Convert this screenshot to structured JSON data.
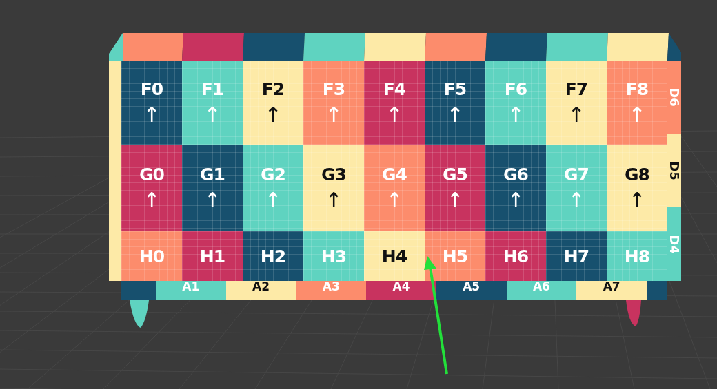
{
  "front_rows": [
    {
      "tiles": [
        {
          "label": "F0",
          "arrow": "↑",
          "color": "#17506e"
        },
        {
          "label": "F1",
          "arrow": "↑",
          "color": "#5fd3c0"
        },
        {
          "label": "F2",
          "arrow": "↑",
          "color": "#fdeaa7"
        },
        {
          "label": "F3",
          "arrow": "↑",
          "color": "#fc8c6c"
        },
        {
          "label": "F4",
          "arrow": "↑",
          "color": "#c8335f"
        },
        {
          "label": "F5",
          "arrow": "↑",
          "color": "#17506e"
        },
        {
          "label": "F6",
          "arrow": "↑",
          "color": "#5fd3c0"
        },
        {
          "label": "F7",
          "arrow": "↑",
          "color": "#fdeaa7"
        },
        {
          "label": "F8",
          "arrow": "↑",
          "color": "#fc8c6c"
        }
      ]
    },
    {
      "tiles": [
        {
          "label": "G0",
          "arrow": "↑",
          "color": "#c8335f"
        },
        {
          "label": "G1",
          "arrow": "↑",
          "color": "#17506e"
        },
        {
          "label": "G2",
          "arrow": "↑",
          "color": "#5fd3c0"
        },
        {
          "label": "G3",
          "arrow": "↑",
          "color": "#fdeaa7"
        },
        {
          "label": "G4",
          "arrow": "↑",
          "color": "#fc8c6c"
        },
        {
          "label": "G5",
          "arrow": "↑",
          "color": "#c8335f"
        },
        {
          "label": "G6",
          "arrow": "↑",
          "color": "#17506e"
        },
        {
          "label": "G7",
          "arrow": "↑",
          "color": "#5fd3c0"
        },
        {
          "label": "G8",
          "arrow": "↑",
          "color": "#fdeaa7"
        }
      ]
    },
    {
      "tiles": [
        {
          "label": "H0",
          "color": "#fc8c6c"
        },
        {
          "label": "H1",
          "color": "#c8335f"
        },
        {
          "label": "H2",
          "color": "#17506e"
        },
        {
          "label": "H3",
          "color": "#5fd3c0"
        },
        {
          "label": "H4",
          "color": "#fdeaa7"
        },
        {
          "label": "H5",
          "color": "#fc8c6c"
        },
        {
          "label": "H6",
          "color": "#c8335f"
        },
        {
          "label": "H7",
          "color": "#17506e"
        },
        {
          "label": "H8",
          "color": "#5fd3c0"
        }
      ]
    }
  ],
  "side_tiles": [
    {
      "label": "D6",
      "color": "#fc8c6c"
    },
    {
      "label": "D5",
      "color": "#fdeaa7"
    },
    {
      "label": "D4",
      "color": "#5fd3c0"
    }
  ],
  "bottom_tiles": [
    {
      "label": "A1",
      "color": "#5fd3c0"
    },
    {
      "label": "A2",
      "color": "#fdeaa7"
    },
    {
      "label": "A3",
      "color": "#fc8c6c"
    },
    {
      "label": "A4",
      "color": "#c8335f"
    },
    {
      "label": "A5",
      "color": "#17506e"
    },
    {
      "label": "A6",
      "color": "#5fd3c0"
    },
    {
      "label": "A7",
      "color": "#fdeaa7"
    }
  ]
}
